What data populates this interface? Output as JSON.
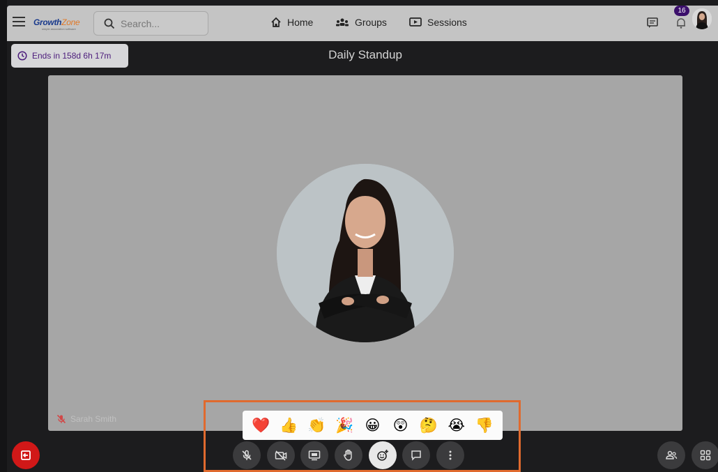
{
  "header": {
    "logo_text_a": "Growth",
    "logo_text_b": "Zone",
    "logo_tagline": "simple association software",
    "search_placeholder": "Search...",
    "nav": [
      {
        "label": "Home",
        "icon": "home-icon"
      },
      {
        "label": "Groups",
        "icon": "groups-icon"
      },
      {
        "label": "Sessions",
        "icon": "sessions-icon"
      }
    ],
    "notification_count": "16"
  },
  "session": {
    "timer": "Ends in 158d 6h 17m",
    "title": "Daily Standup"
  },
  "tile": {
    "participant_name": "Sarah Smith"
  },
  "reactions": [
    "❤️",
    "👍",
    "👏",
    "🎉",
    "😀",
    "😲",
    "🤔",
    "😭",
    "👎"
  ],
  "controls": [
    {
      "name": "mic-off-button",
      "icon": "mic-off-icon"
    },
    {
      "name": "camera-off-button",
      "icon": "camera-off-icon"
    },
    {
      "name": "share-screen-button",
      "icon": "screen-share-icon"
    },
    {
      "name": "raise-hand-button",
      "icon": "hand-icon"
    },
    {
      "name": "reactions-button",
      "icon": "emoji-add-icon",
      "active": true
    },
    {
      "name": "chat-button",
      "icon": "chat-icon"
    },
    {
      "name": "more-options-button",
      "icon": "more-vertical-icon"
    }
  ],
  "colors": {
    "accent": "#4b1b7b",
    "highlight": "#e06a2e",
    "leave": "#d11818"
  }
}
